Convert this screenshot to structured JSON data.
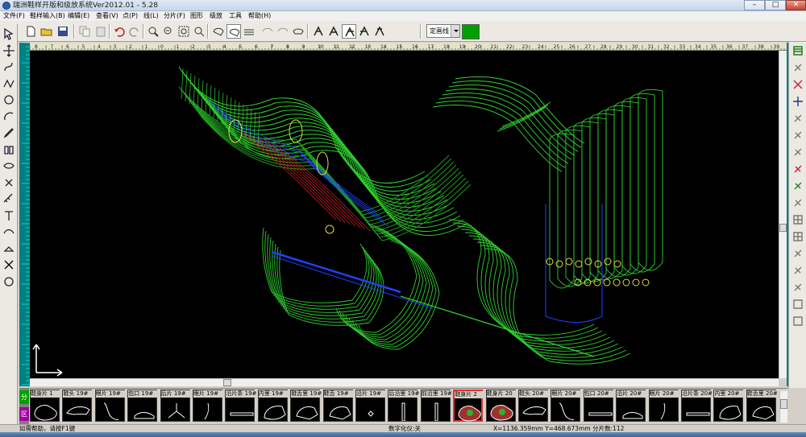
{
  "window": {
    "title": "瑞洲鞋样开版和级放系统Ver2012.01 - 5.28",
    "min_glyph": "–",
    "max_glyph": "□",
    "close_glyph": "✕"
  },
  "menu": [
    "文件(F)",
    "鞋样输入(B)",
    "编辑(E)",
    "查看(V)",
    "点(P)",
    "线(L)",
    "分片(F)",
    "图形",
    "级放",
    "工具",
    "帮助(H)"
  ],
  "toolbar": {
    "line_type_value": "定画线",
    "color_value": "#00a000",
    "buttons": [
      "new-file",
      "open-file",
      "save-file",
      "copy",
      "paste",
      "undo",
      "redo",
      "zoom-in",
      "zoom-out",
      "zoom-window",
      "zoom-all",
      "shoe-last-1",
      "shoe-last-2",
      "shoe-last-3",
      "shoe-last-4",
      "shoe-last-5",
      "shoe-last-6",
      "piece-tool-1",
      "piece-tool-2",
      "piece-tool-3",
      "piece-tool-4",
      "piece-tool-5"
    ]
  },
  "left_tools": [
    "select-arrow-icon",
    "move-cross-icon",
    "curve-icon",
    "zigzag-icon",
    "circle-icon",
    "arc-icon",
    "pen-icon",
    "mirror-icon",
    "eye-icon",
    "cut-icon",
    "measure-icon",
    "text-icon",
    "trace-icon",
    "erase-icon",
    "delete-icon",
    "digitize-icon"
  ],
  "right_tools": [
    "layers-icon",
    "brush-icon",
    "red-cross-icon",
    "plus-icon",
    "star-icon",
    "star2-icon",
    "spark-icon",
    "chain-icon",
    "check-icon",
    "link-icon",
    "grid-icon",
    "grid2-icon",
    "blank-icon",
    "arrow-icon",
    "arrows-icon",
    "box-icon",
    "box2-icon"
  ],
  "ruler_numbers": [
    "8",
    "7",
    "6",
    "5",
    "4",
    "3",
    "2",
    "1",
    "0",
    "1",
    "2",
    "3",
    "4",
    "5",
    "6",
    "7",
    "8",
    "9",
    "10",
    "11",
    "12",
    "13",
    "14",
    "15",
    "16",
    "17",
    "18",
    "19",
    "20",
    "21",
    "22",
    "23",
    "24",
    "25",
    "26",
    "27",
    "28",
    "29",
    "30",
    "31",
    "32",
    "33",
    "34",
    "35",
    "36",
    "37",
    "38",
    "39",
    "40"
  ],
  "panel_tabs": {
    "pieces": "分片",
    "area": "区"
  },
  "pieces": [
    {
      "label": "鞋身片 1",
      "shape": "body",
      "selected": false
    },
    {
      "label": "鞋头 19#",
      "shape": "toe",
      "selected": false
    },
    {
      "label": "眼片 19#",
      "shape": "eye",
      "selected": false
    },
    {
      "label": "包口 19#",
      "shape": "collar",
      "selected": false
    },
    {
      "label": "后片 19#",
      "shape": "heel",
      "selected": false
    },
    {
      "label": "眼片 19#",
      "shape": "stem",
      "selected": false
    },
    {
      "label": "沿片条 19#",
      "shape": "strip",
      "selected": false
    },
    {
      "label": "内里 19#",
      "shape": "lining",
      "selected": false
    },
    {
      "label": "鞋舌里 19#",
      "shape": "tongue",
      "selected": false
    },
    {
      "label": "鞋舌 19#",
      "shape": "tongue2",
      "selected": false
    },
    {
      "label": "沿片 19#",
      "shape": "dot",
      "selected": false
    },
    {
      "label": "后沿里 19#",
      "shape": "bar",
      "selected": false
    },
    {
      "label": "前沿里 19#",
      "shape": "bar2",
      "selected": false
    },
    {
      "label": "鞋身片 2",
      "shape": "body2",
      "selected": true
    },
    {
      "label": "鞋身片 20",
      "shape": "body3",
      "selected": false
    },
    {
      "label": "鞋头 20#",
      "shape": "toe",
      "selected": false
    },
    {
      "label": "眼片 20#",
      "shape": "eye",
      "selected": false
    },
    {
      "label": "包口 20#",
      "shape": "strip",
      "selected": false
    },
    {
      "label": "沿片 20#",
      "shape": "collar",
      "selected": false
    },
    {
      "label": "眼片 20#",
      "shape": "stem",
      "selected": false
    },
    {
      "label": "沿片条 20#",
      "shape": "strip",
      "selected": false
    },
    {
      "label": "内里 20#",
      "shape": "lining",
      "selected": false
    },
    {
      "label": "鞋舌里 20#",
      "shape": "tongue",
      "selected": false
    }
  ],
  "status": {
    "help": "如需帮助，请按F1键",
    "digitize": "数字化仪:关",
    "coords": "X=1136.359mm Y=468.673mm 分片数:112"
  }
}
